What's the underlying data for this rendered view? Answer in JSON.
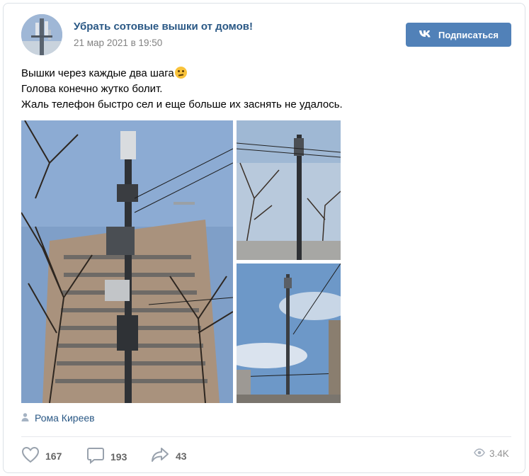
{
  "post": {
    "group_name": "Убрать сотовые вышки от домов!",
    "date": "21 мар 2021 в 19:50",
    "subscribe_label": "Подписаться",
    "text_lines": [
      "Вышки через каждые два шага",
      "Голова конечно жутко болит.",
      "Жаль телефон быстро сел и еще больше их заснять не удалось."
    ],
    "emoji": "confused-face-emoji",
    "author": "Рома Киреев",
    "photos": [
      {
        "icon": "cell-tower-photo-building"
      },
      {
        "icon": "cell-tower-photo-trees"
      },
      {
        "icon": "cell-tower-photo-street"
      }
    ]
  },
  "footer": {
    "likes": "167",
    "comments": "193",
    "shares": "43",
    "views": "3.4K"
  },
  "colors": {
    "accent": "#5181b8",
    "link": "#2a5885",
    "muted": "#828282"
  }
}
